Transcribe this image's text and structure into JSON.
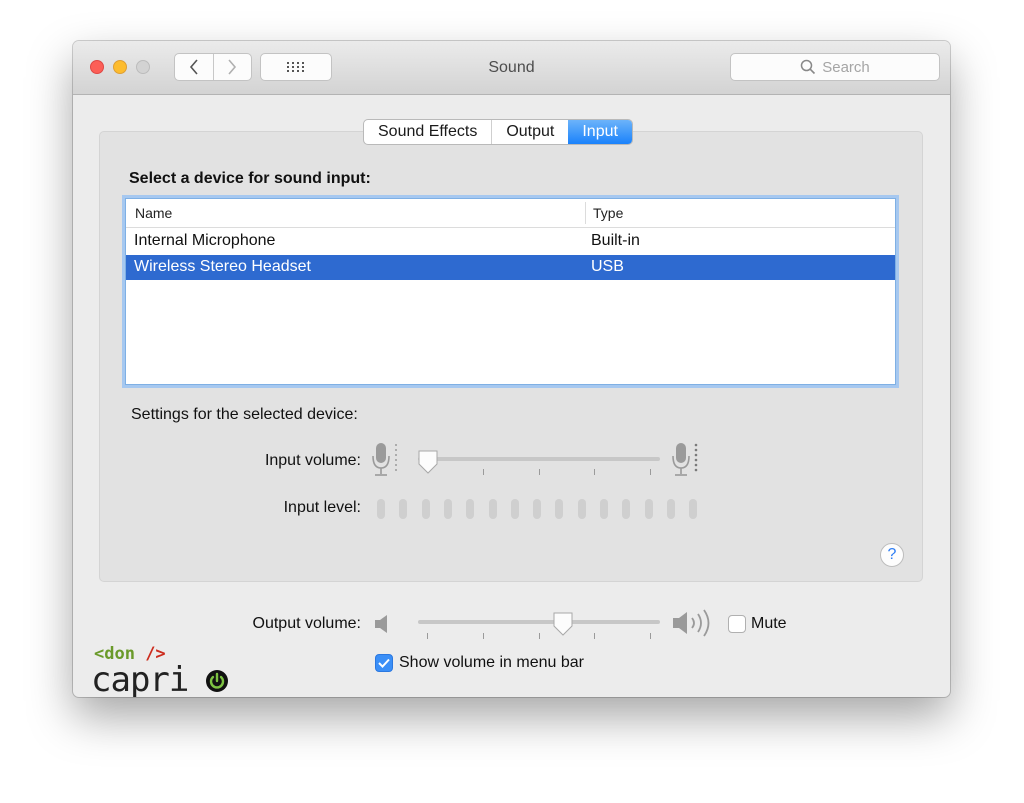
{
  "window": {
    "title": "Sound",
    "search_placeholder": "Search"
  },
  "tabs": [
    {
      "label": "Sound Effects",
      "active": false
    },
    {
      "label": "Output",
      "active": false
    },
    {
      "label": "Input",
      "active": true
    }
  ],
  "input": {
    "section_title": "Select a device for sound input:",
    "columns": [
      "Name",
      "Type"
    ],
    "devices": [
      {
        "name": "Internal Microphone",
        "type": "Built-in",
        "selected": false
      },
      {
        "name": "Wireless Stereo Headset",
        "type": "USB",
        "selected": true
      }
    ],
    "settings_label": "Settings for the selected device:",
    "volume_label": "Input volume:",
    "volume_level": 0.0,
    "level_label": "Input level:",
    "level_segments_lit": 0,
    "level_segments_total": 15
  },
  "output": {
    "volume_label": "Output volume:",
    "volume_level": 0.6,
    "mute_label": "Mute",
    "mute_checked": false
  },
  "menu_bar": {
    "label": "Show volume in menu bar",
    "checked": true
  },
  "help": {
    "glyph": "?"
  },
  "watermark": {
    "tag": "<don />",
    "name": "capri"
  },
  "colors": {
    "accent": "#1a82fb",
    "selection": "#2e6ad0",
    "logo_green": "#6a9a2a",
    "logo_red": "#cc2b1d"
  }
}
